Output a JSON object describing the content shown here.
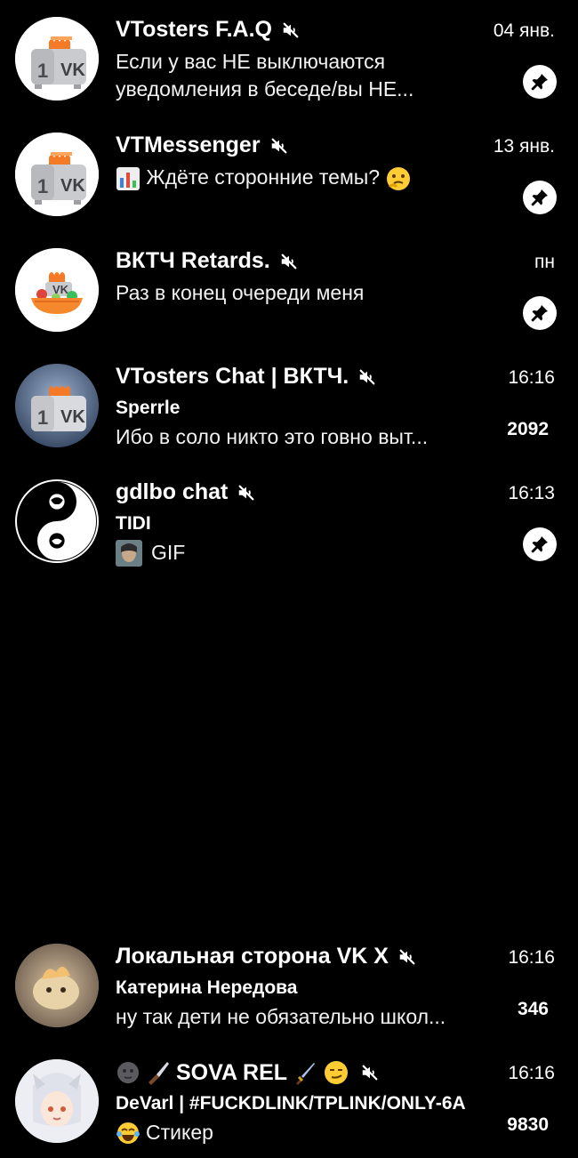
{
  "chats": [
    {
      "title": "VTosters F.A.Q",
      "date": "04 янв.",
      "preview_line1": "Если у вас НЕ выключаются",
      "preview_line2": "уведомления в беседе/вы НЕ..."
    },
    {
      "title": "VTMessenger",
      "date": "13 янв.",
      "preview": "Ждёте сторонние темы?"
    },
    {
      "title": "ВКТЧ Retards.",
      "date": "пн",
      "preview": "Раз в конец очереди меня"
    },
    {
      "title": "VTosters Chat | ВКТЧ.",
      "date": "16:16",
      "sender": "Sperrle",
      "preview": "Ибо в соло никто это говно выт...",
      "unread": "2092"
    },
    {
      "title": "gdlbo chat",
      "date": "16:13",
      "sender": "TIDI",
      "preview": "GIF"
    },
    {
      "title": "Локальная сторона VK X",
      "date": "16:16",
      "sender": "Катерина Нередова",
      "preview": "ну так дети не обязательно школ...",
      "unread": "346"
    },
    {
      "title": "SOVA REL",
      "date": "16:16",
      "sender": "DeVarl | #FUCKDLINK/TPLINK/ONLY-6A",
      "preview": "Стикер",
      "unread": "9830"
    }
  ],
  "icons": {
    "mute": "speaker-muted-icon",
    "pin": "pin-icon"
  },
  "colors": {
    "background": "#000000",
    "text": "#ffffff",
    "vk_orange": "#f57a27",
    "vk_gray": "#c9cbcf"
  }
}
